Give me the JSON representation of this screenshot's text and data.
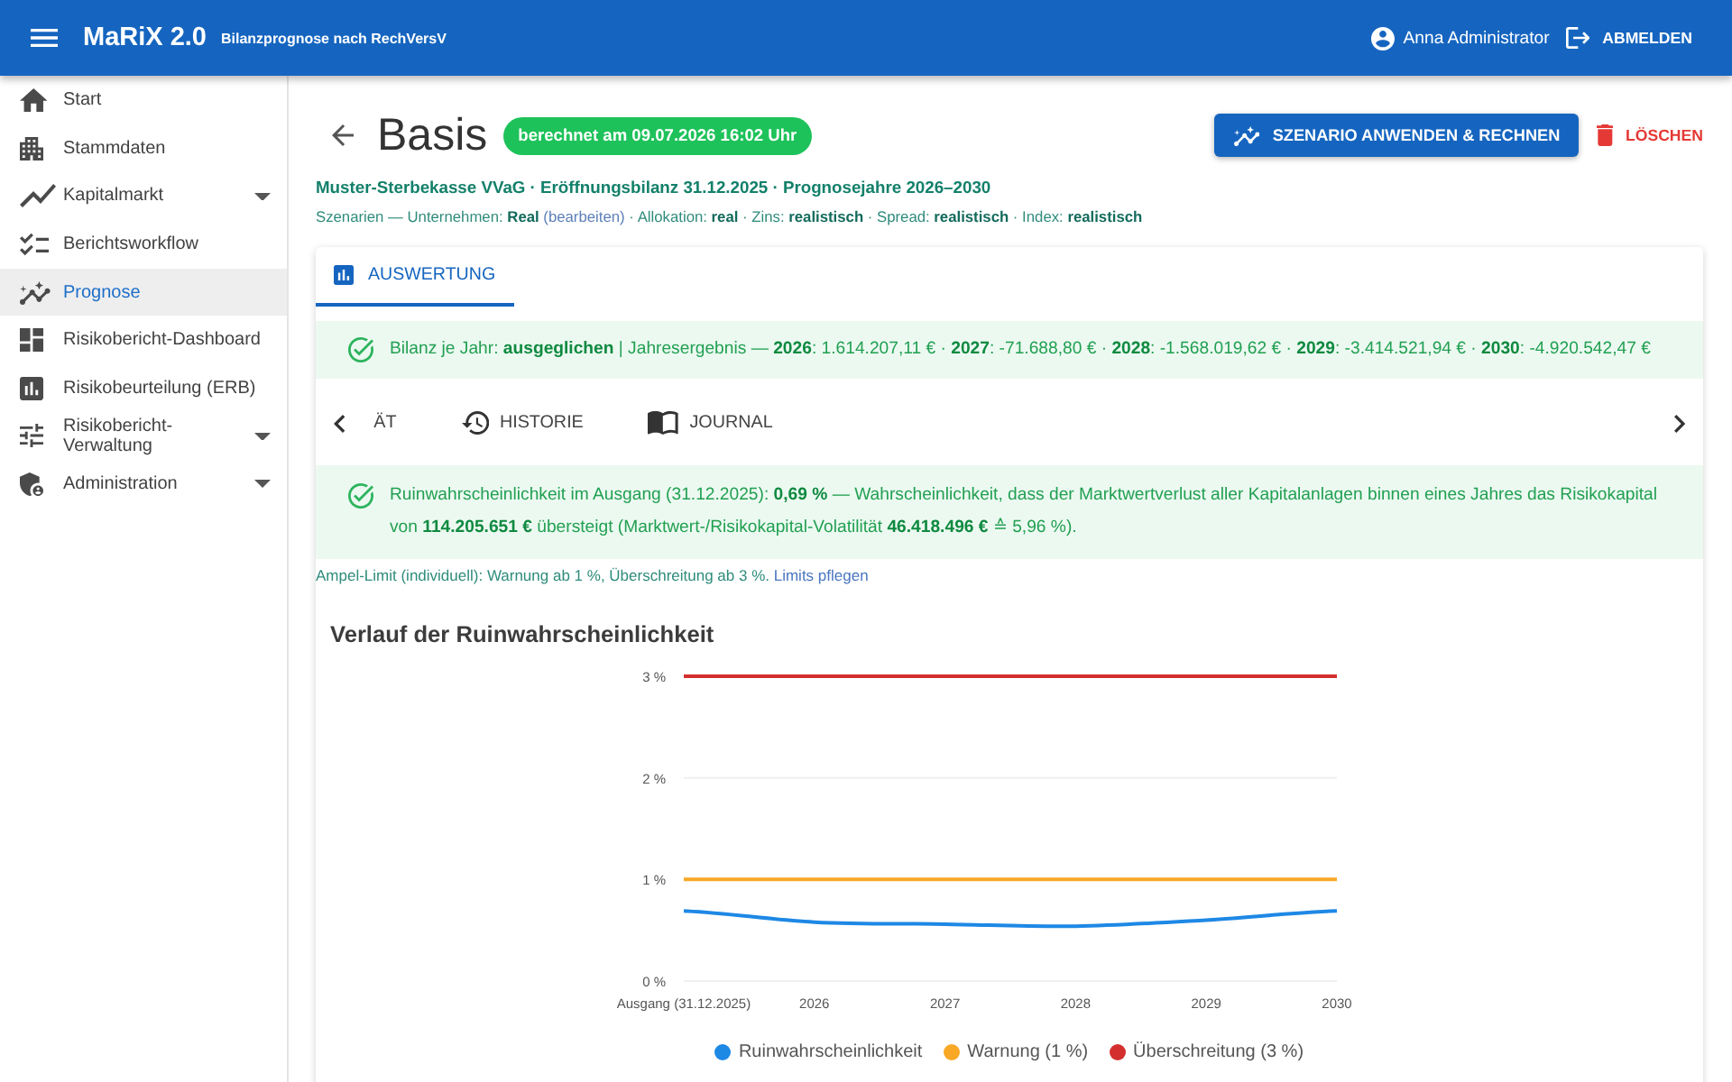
{
  "app_bar": {
    "title": "MaRiX 2.0",
    "subtitle": "Bilanzprognose nach RechVersV",
    "user": "Anna Administrator",
    "logout": "ABMELDEN"
  },
  "sidebar": {
    "items": [
      {
        "label": "Start",
        "selected": false,
        "expandable": false
      },
      {
        "label": "Stammdaten",
        "selected": false,
        "expandable": false
      },
      {
        "label": "Kapitalmarkt",
        "selected": false,
        "expandable": true
      },
      {
        "label": "Berichtsworkflow",
        "selected": false,
        "expandable": false
      },
      {
        "label": "Prognose",
        "selected": true,
        "expandable": false
      },
      {
        "label": "Risikobericht-Dashboard",
        "selected": false,
        "expandable": false
      },
      {
        "label": "Risikobeurteilung (ERB)",
        "selected": false,
        "expandable": false
      },
      {
        "label": "Risikobericht-Verwaltung",
        "selected": false,
        "expandable": true
      },
      {
        "label": "Administration",
        "selected": false,
        "expandable": true
      }
    ]
  },
  "header": {
    "title": "Basis",
    "status_badge": "berechnet am 09.07.2026 16:02 Uhr",
    "actions": [
      {
        "label": "SZENARIO ANWENDEN & RECHNEN",
        "kind": "primary"
      },
      {
        "label": "LÖSCHEN",
        "kind": "danger"
      }
    ],
    "subtitle": "Muster-Sterbekasse VVaG · Eröffnungsbilanz 31.12.2025 · Prognosejahre 2026–2030",
    "scenarios": {
      "before": "Szenarien — Unternehmen: **Real**",
      "link": "(bearbeiten)",
      "after": "· Allokation: **real** · Zins: **realistisch** · Spread: **realistisch** · Index: **realistisch**"
    }
  },
  "card": {
    "tabs": [
      {
        "label": "AUSWERTUNG",
        "selected": true
      }
    ],
    "balance_alert": "Bilanz je Jahr: **ausgeglichen** | Jahresergebnis — **2026**: 1.614.207,11 € · **2027**: -71.688,80 € · **2028**: -1.568.019,62 € · **2029**: -3.414.521,94 € · **2030**: -4.920.542,47 €",
    "sub_tabs": [
      {
        "label": "ÄT",
        "selected": false
      },
      {
        "label": "HISTORIE",
        "selected": false
      },
      {
        "label": "JOURNAL",
        "selected": false
      }
    ],
    "ruin_alert": "Ruinwahrscheinlichkeit im Ausgang (31.12.2025): **0,69 %** — Wahrscheinlichkeit, dass der Marktwertverlust aller Kapitalanlagen binnen eines Jahres das Risikokapital von **114.205.651 €** übersteigt (Marktwert-/Risikokapital-Volatilität **46.418.496 €** ≙ 5,96 %).",
    "limit_note": {
      "text": "Ampel-Limit (individuell): Warnung ab 1 %, Überschreitung ab 3 %.",
      "link": "Limits pflegen"
    },
    "chart": {
      "title": "Verlauf der Ruinwahrscheinlichkeit",
      "chart_data": {
        "type": "line",
        "categories": [
          "Ausgang (31.12.2025)",
          "2026",
          "2027",
          "2028",
          "2029",
          "2030"
        ],
        "series": [
          {
            "name": "Ruinwahrscheinlichkeit",
            "color": "#1e88e5",
            "values": [
              0.69,
              0.58,
              0.56,
              0.54,
              0.6,
              0.69
            ]
          },
          {
            "name": "Warnung (1 %)",
            "color": "#f9a825",
            "values": [
              1,
              1,
              1,
              1,
              1,
              1
            ]
          },
          {
            "name": "Überschreitung (3 %)",
            "color": "#d32f2f",
            "values": [
              3,
              3,
              3,
              3,
              3,
              3
            ]
          }
        ],
        "ylim": [
          0,
          3
        ],
        "yticks": [
          {
            "value": 0,
            "label": "0 %"
          },
          {
            "value": 1,
            "label": "1 %"
          },
          {
            "value": 2,
            "label": "2 %"
          },
          {
            "value": 3,
            "label": "3 %"
          }
        ]
      }
    }
  }
}
